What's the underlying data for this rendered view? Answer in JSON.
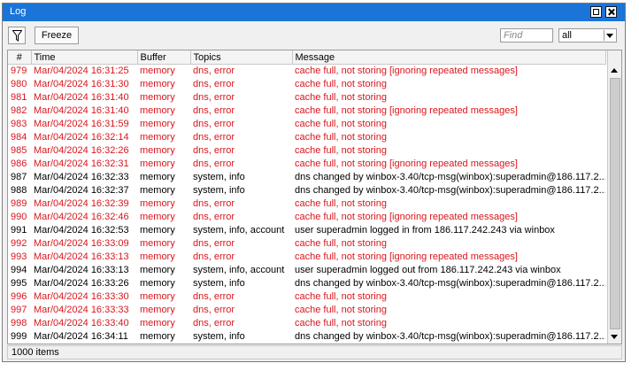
{
  "window": {
    "title": "Log"
  },
  "toolbar": {
    "freeze_label": "Freeze",
    "find_placeholder": "Find",
    "filter_value": "all"
  },
  "columns": [
    "#",
    "Time",
    "Buffer",
    "Topics",
    "Message"
  ],
  "rows": [
    {
      "num": "979",
      "time": "Mar/04/2024 16:31:25",
      "buffer": "memory",
      "topics": "dns, error",
      "message": "cache full, not storing [ignoring repeated messages]",
      "level": "error"
    },
    {
      "num": "980",
      "time": "Mar/04/2024 16:31:30",
      "buffer": "memory",
      "topics": "dns, error",
      "message": "cache full, not storing",
      "level": "error"
    },
    {
      "num": "981",
      "time": "Mar/04/2024 16:31:40",
      "buffer": "memory",
      "topics": "dns, error",
      "message": "cache full, not storing",
      "level": "error"
    },
    {
      "num": "982",
      "time": "Mar/04/2024 16:31:40",
      "buffer": "memory",
      "topics": "dns, error",
      "message": "cache full, not storing [ignoring repeated messages]",
      "level": "error"
    },
    {
      "num": "983",
      "time": "Mar/04/2024 16:31:59",
      "buffer": "memory",
      "topics": "dns, error",
      "message": "cache full, not storing",
      "level": "error"
    },
    {
      "num": "984",
      "time": "Mar/04/2024 16:32:14",
      "buffer": "memory",
      "topics": "dns, error",
      "message": "cache full, not storing",
      "level": "error"
    },
    {
      "num": "985",
      "time": "Mar/04/2024 16:32:26",
      "buffer": "memory",
      "topics": "dns, error",
      "message": "cache full, not storing",
      "level": "error"
    },
    {
      "num": "986",
      "time": "Mar/04/2024 16:32:31",
      "buffer": "memory",
      "topics": "dns, error",
      "message": "cache full, not storing [ignoring repeated messages]",
      "level": "error"
    },
    {
      "num": "987",
      "time": "Mar/04/2024 16:32:33",
      "buffer": "memory",
      "topics": "system, info",
      "message": "dns changed by winbox-3.40/tcp-msg(winbox):superadmin@186.117.2...",
      "level": "info"
    },
    {
      "num": "988",
      "time": "Mar/04/2024 16:32:37",
      "buffer": "memory",
      "topics": "system, info",
      "message": "dns changed by winbox-3.40/tcp-msg(winbox):superadmin@186.117.2...",
      "level": "info"
    },
    {
      "num": "989",
      "time": "Mar/04/2024 16:32:39",
      "buffer": "memory",
      "topics": "dns, error",
      "message": "cache full, not storing",
      "level": "error"
    },
    {
      "num": "990",
      "time": "Mar/04/2024 16:32:46",
      "buffer": "memory",
      "topics": "dns, error",
      "message": "cache full, not storing [ignoring repeated messages]",
      "level": "error"
    },
    {
      "num": "991",
      "time": "Mar/04/2024 16:32:53",
      "buffer": "memory",
      "topics": "system, info, account",
      "message": "user superadmin logged in from 186.117.242.243 via winbox",
      "level": "info"
    },
    {
      "num": "992",
      "time": "Mar/04/2024 16:33:09",
      "buffer": "memory",
      "topics": "dns, error",
      "message": "cache full, not storing",
      "level": "error"
    },
    {
      "num": "993",
      "time": "Mar/04/2024 16:33:13",
      "buffer": "memory",
      "topics": "dns, error",
      "message": "cache full, not storing [ignoring repeated messages]",
      "level": "error"
    },
    {
      "num": "994",
      "time": "Mar/04/2024 16:33:13",
      "buffer": "memory",
      "topics": "system, info, account",
      "message": "user superadmin logged out from 186.117.242.243 via winbox",
      "level": "info"
    },
    {
      "num": "995",
      "time": "Mar/04/2024 16:33:26",
      "buffer": "memory",
      "topics": "system, info",
      "message": "dns changed by winbox-3.40/tcp-msg(winbox):superadmin@186.117.2...",
      "level": "info"
    },
    {
      "num": "996",
      "time": "Mar/04/2024 16:33:30",
      "buffer": "memory",
      "topics": "dns, error",
      "message": "cache full, not storing",
      "level": "error"
    },
    {
      "num": "997",
      "time": "Mar/04/2024 16:33:33",
      "buffer": "memory",
      "topics": "dns, error",
      "message": "cache full, not storing",
      "level": "error"
    },
    {
      "num": "998",
      "time": "Mar/04/2024 16:33:40",
      "buffer": "memory",
      "topics": "dns, error",
      "message": "cache full, not storing",
      "level": "error"
    },
    {
      "num": "999",
      "time": "Mar/04/2024 16:34:11",
      "buffer": "memory",
      "topics": "system, info",
      "message": "dns changed by winbox-3.40/tcp-msg(winbox):superadmin@186.117.2...",
      "level": "info"
    }
  ],
  "status": {
    "count_text": "1000 items"
  },
  "colors": {
    "titlebar": "#1b74d8",
    "error_text": "#d9161c"
  },
  "icons": {
    "filter": "funnel-icon",
    "maximize": "maximize-icon",
    "close": "close-icon"
  }
}
